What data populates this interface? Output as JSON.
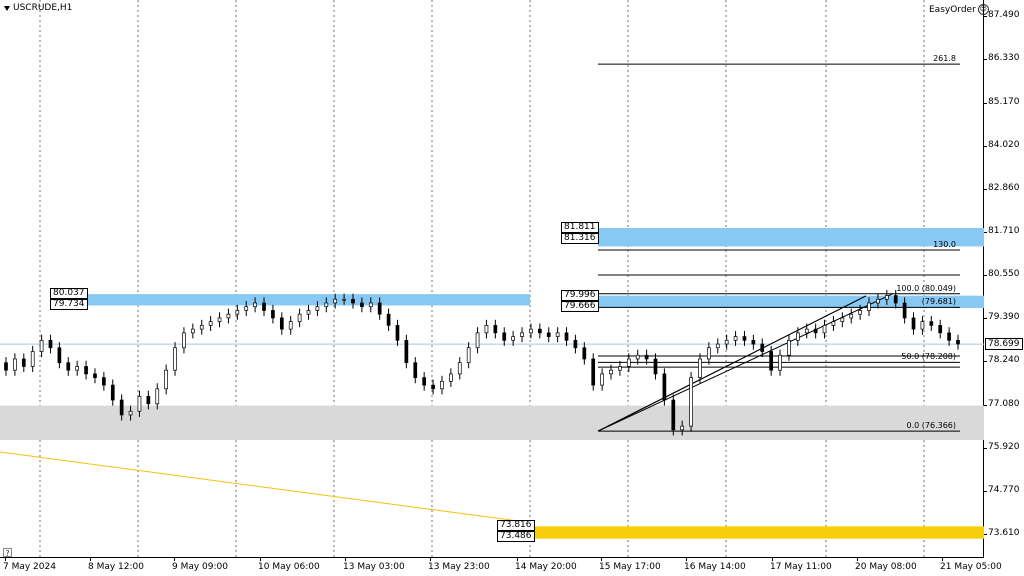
{
  "chart": {
    "symbol": "USCRUDE,H1",
    "easy_order": "EasyOrder",
    "current_price": "78.699",
    "help": "?"
  },
  "colors": {
    "bull": "#ffffff",
    "bear": "#000000",
    "blue_zone": "#87c9f3",
    "gray_zone": "#d9d9d9",
    "gold_zone": "#f6cf0a",
    "gold_line": "#f4c20d",
    "grid": "#000000",
    "crosshair": "#a8c8e8"
  },
  "price_axis": {
    "labels": [
      "87.490",
      "86.330",
      "85.170",
      "84.020",
      "82.860",
      "81.710",
      "80.550",
      "79.390",
      "78.240",
      "77.080",
      "75.920",
      "74.770",
      "73.610"
    ],
    "values": [
      87.49,
      86.33,
      85.17,
      84.02,
      82.86,
      81.71,
      80.55,
      79.39,
      78.24,
      77.08,
      75.92,
      74.77,
      73.61
    ]
  },
  "time_axis": {
    "labels": [
      "7 May 2024",
      "8 May 12:00",
      "9 May 09:00",
      "10 May 06:00",
      "13 May 03:00",
      "13 May 23:00",
      "14 May 20:00",
      "15 May 17:00",
      "16 May 14:00",
      "17 May 11:00",
      "20 May 08:00",
      "21 May 05:00"
    ]
  },
  "zones": [
    {
      "name": "blue-zone-left",
      "color": "blue_zone",
      "top": 80.037,
      "bottom": 79.734,
      "labels": [
        "80.037",
        "79.734"
      ]
    },
    {
      "name": "blue-zone-right-upper",
      "color": "blue_zone",
      "top": 81.811,
      "bottom": 81.316,
      "labels": [
        "81.811",
        "81.316"
      ]
    },
    {
      "name": "blue-zone-right-lower",
      "color": "blue_zone",
      "top": 79.996,
      "bottom": 79.666,
      "labels": [
        "79.996",
        "79.666"
      ]
    },
    {
      "name": "gold-zone",
      "color": "gold_zone",
      "top": 73.816,
      "bottom": 73.486,
      "labels": [
        "73.816",
        "73.486"
      ]
    },
    {
      "name": "gray-zone",
      "color": "gray_zone",
      "top": 77.05,
      "bottom": 76.13,
      "labels": []
    }
  ],
  "fibonacci": [
    {
      "label": "261.8",
      "price": 86.2
    },
    {
      "label": "130.0",
      "price": 81.22
    },
    {
      "label": "100.0 (80.049)",
      "price": 80.049
    },
    {
      "label": "(79.681)",
      "price": 79.681
    },
    {
      "label": "50.0 (78.208)",
      "price": 78.208
    },
    {
      "label": "0.0 (76.366)",
      "price": 76.366
    }
  ],
  "fib_extra_levels": [
    80.55,
    78.38,
    78.08
  ],
  "candles_close": [
    78.0,
    78.3,
    78.1,
    78.5,
    78.8,
    78.6,
    78.2,
    78.0,
    78.1,
    77.9,
    77.8,
    77.6,
    77.2,
    76.8,
    76.9,
    77.3,
    77.1,
    77.5,
    78.0,
    78.6,
    79.0,
    79.1,
    79.2,
    79.3,
    79.4,
    79.5,
    79.6,
    79.7,
    79.8,
    79.6,
    79.4,
    79.1,
    79.3,
    79.5,
    79.6,
    79.7,
    79.8,
    79.9,
    79.9,
    79.8,
    79.7,
    79.8,
    79.5,
    79.2,
    78.8,
    78.2,
    77.8,
    77.6,
    77.5,
    77.7,
    77.9,
    78.2,
    78.6,
    79.0,
    79.2,
    79.0,
    78.8,
    78.9,
    79.0,
    79.1,
    79.0,
    78.9,
    79.0,
    78.8,
    78.6,
    78.3,
    77.6,
    77.9,
    78.0,
    78.1,
    78.3,
    78.4,
    78.3,
    77.9,
    77.2,
    76.4,
    76.5,
    77.8,
    78.3,
    78.6,
    78.7,
    78.8,
    78.9,
    78.8,
    78.7,
    78.5,
    78.0,
    78.4,
    78.8,
    79.0,
    79.1,
    79.0,
    79.2,
    79.3,
    79.4,
    79.5,
    79.6,
    79.8,
    79.9,
    80.0,
    79.8,
    79.4,
    79.1,
    79.3,
    79.2,
    79.0,
    78.8,
    78.7
  ]
}
